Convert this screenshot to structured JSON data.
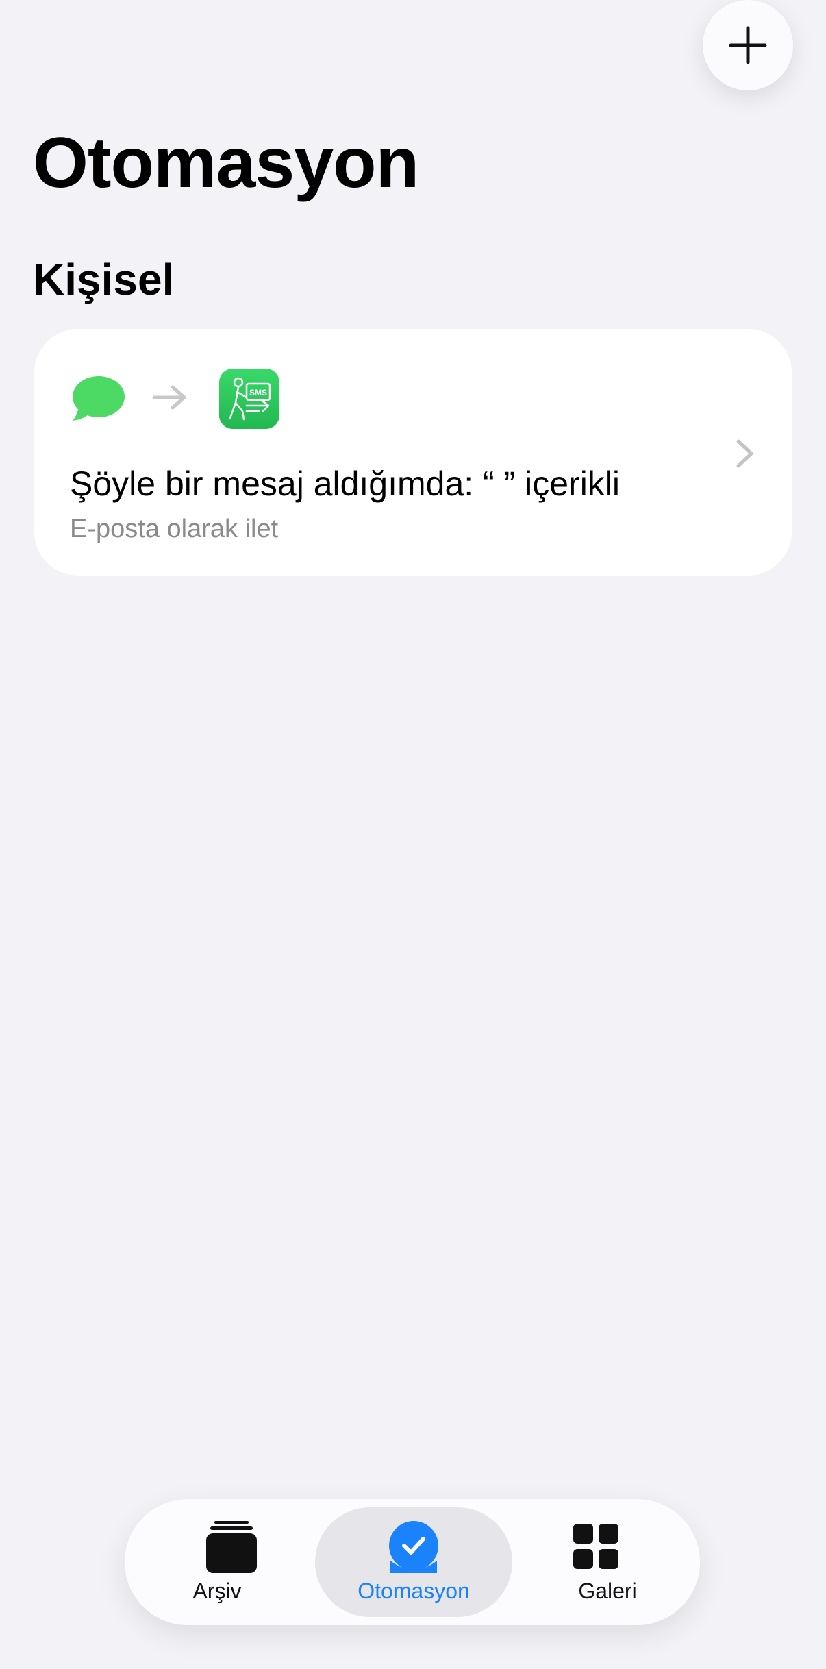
{
  "header": {
    "add_icon": "plus-icon"
  },
  "page": {
    "title": "Otomasyon"
  },
  "section": {
    "title": "Kişisel"
  },
  "automation": {
    "trigger_icon": "messages-icon",
    "arrow_icon": "arrow-right-icon",
    "action_icon": "sms-forward-app-icon",
    "sms_badge": "SMS",
    "title": "Şöyle bir mesaj aldığımda: “ ” içerikli",
    "subtitle": "E-posta olarak ilet",
    "accent_color": "#2ecc5e"
  },
  "tabbar": {
    "active_color": "#1a82fb",
    "tabs": [
      {
        "label": "Arşiv",
        "icon": "archive-stack-icon",
        "active": false
      },
      {
        "label": "Otomasyon",
        "icon": "automation-check-icon",
        "active": true
      },
      {
        "label": "Galeri",
        "icon": "gallery-grid-icon",
        "active": false
      }
    ]
  }
}
